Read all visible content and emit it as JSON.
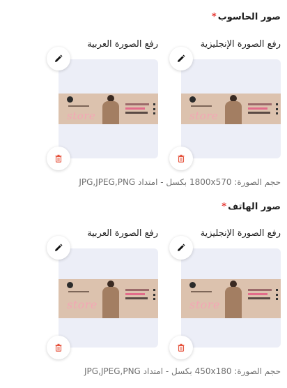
{
  "desktop": {
    "title": "صور الحاسوب",
    "required_mark": "*",
    "english_label": "رفع الصورة الإنجليزية",
    "arabic_label": "رفع الصورة العربية",
    "hint": "حجم الصورة: 1800x570 بكسل - امتداد JPG,JPEG,PNG"
  },
  "mobile": {
    "title": "صور الهاتف",
    "required_mark": "*",
    "english_label": "رفع الصورة الإنجليزية",
    "arabic_label": "رفع الصورة العربية",
    "hint": "حجم الصورة: 450x180 بكسل - امتداد JPG,JPEG,PNG"
  },
  "banner": {
    "text": "store"
  },
  "icons": {
    "edit": "pencil-icon",
    "delete": "trash-icon"
  },
  "colors": {
    "required": "#e53935",
    "delete": "#e5533d",
    "card_bg": "#eceef7",
    "banner_bg": "#dcc2ae"
  }
}
